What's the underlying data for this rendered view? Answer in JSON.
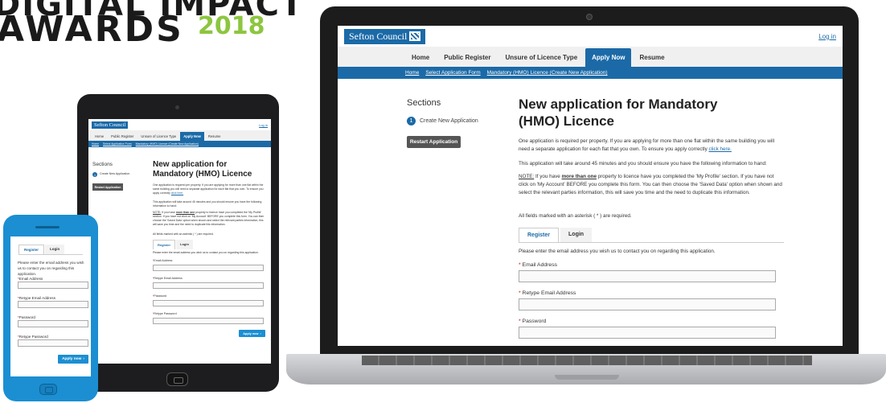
{
  "award": {
    "line1": "DIGITAL IMPACT",
    "line2": "AWARDS",
    "year": "2018"
  },
  "site": {
    "logo": "Sefton Council",
    "login": "Log in",
    "nav": [
      "Home",
      "Public Register",
      "Unsure of Licence Type",
      "Apply Now",
      "Resume"
    ],
    "nav_active": "Apply Now",
    "breadcrumbs": [
      "Home",
      "Select Application Form",
      "Mandatory (HMO) Licence (Create New Application)"
    ],
    "sections_title": "Sections",
    "section_step_num": "1",
    "section_step": "Create New Application",
    "restart_button": "Restart Application",
    "page_title": "New application for Mandatory (HMO) Licence",
    "para1": "One application is required per property. If you are applying for more than one flat within the same building you will need a separate application for each flat that you own. To ensure you apply correctly",
    "para1_link": "click here.",
    "para2": "This application will take around 45 minutes and you should ensure you have the following information to hand:",
    "para3_note": "NOTE:",
    "para3_a": " If you have ",
    "para3_bold": "more than one",
    "para3_b": " property to licence have you completed the 'My Profile' section. If you have not click on 'My Account' BEFORE you complete this form. You can then choose the 'Saved Data' option when shown and select the relevant parties information, this will save you time and the need to duplicate this information.",
    "para4": "All fields marked with an asterisk ( * ) are required.",
    "tabs": [
      "Register",
      "Login"
    ],
    "contact_text": "Please enter the email address you wish us to contact you on regarding this application.",
    "fields": [
      "Email Address",
      "Retype Email Address",
      "Password",
      "Retype Password"
    ],
    "required_mark": "*",
    "apply_button": "Apply now",
    "apply_arrow": "›"
  },
  "phone": {
    "contact_text": "Please enter the email address you wish us to contact you on regarding this application.",
    "apply_button": "Apply now"
  }
}
